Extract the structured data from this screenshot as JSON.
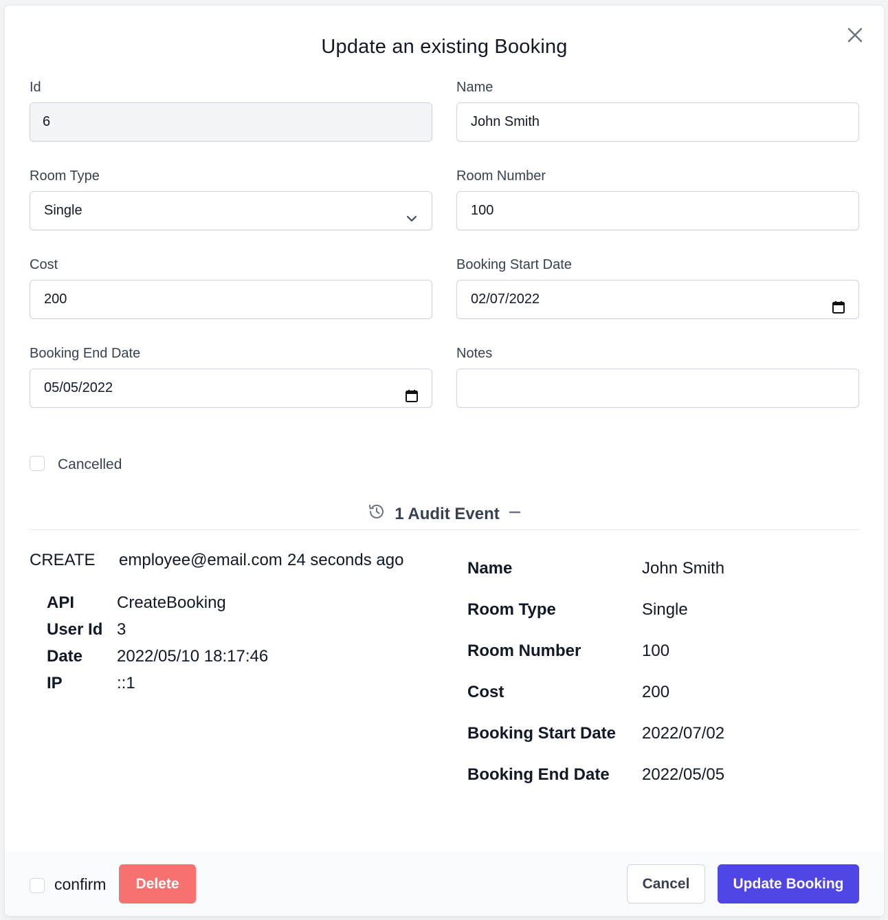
{
  "modal": {
    "title": "Update an existing Booking",
    "close_icon": "x-icon"
  },
  "form": {
    "id": {
      "label": "Id",
      "value": "6"
    },
    "name": {
      "label": "Name",
      "value": "John Smith"
    },
    "room_type": {
      "label": "Room Type",
      "value": "Single",
      "icon": "chevron-down-icon"
    },
    "room_number": {
      "label": "Room Number",
      "value": "100"
    },
    "cost": {
      "label": "Cost",
      "value": "200"
    },
    "booking_start_date": {
      "label": "Booking Start Date",
      "value": "02/07/2022",
      "icon": "calendar-icon"
    },
    "booking_end_date": {
      "label": "Booking End Date",
      "value": "05/05/2022",
      "icon": "calendar-icon"
    },
    "notes": {
      "label": "Notes",
      "value": ""
    },
    "cancelled": {
      "label": "Cancelled",
      "checked": false
    }
  },
  "audit": {
    "heading": "1 Audit Event",
    "history_icon": "history-icon",
    "collapse_icon": "minus-icon",
    "event": {
      "action": "CREATE",
      "user": "employee@email.com",
      "when": "24 seconds ago",
      "details": [
        {
          "key": "API",
          "value": "CreateBooking"
        },
        {
          "key": "User Id",
          "value": "3"
        },
        {
          "key": "Date",
          "value": "2022/05/10 18:17:46"
        },
        {
          "key": "IP",
          "value": "::1"
        }
      ],
      "changes": [
        {
          "key": "Name",
          "value": "John Smith"
        },
        {
          "key": "Room Type",
          "value": "Single"
        },
        {
          "key": "Room Number",
          "value": "100"
        },
        {
          "key": "Cost",
          "value": "200"
        },
        {
          "key": "Booking Start Date",
          "value": "2022/07/02"
        },
        {
          "key": "Booking End Date",
          "value": "2022/05/05"
        }
      ]
    }
  },
  "footer": {
    "confirm_label": "confirm",
    "delete_label": "Delete",
    "cancel_label": "Cancel",
    "update_label": "Update Booking"
  },
  "colors": {
    "primary": "#4f46e5",
    "danger": "#f87171"
  }
}
